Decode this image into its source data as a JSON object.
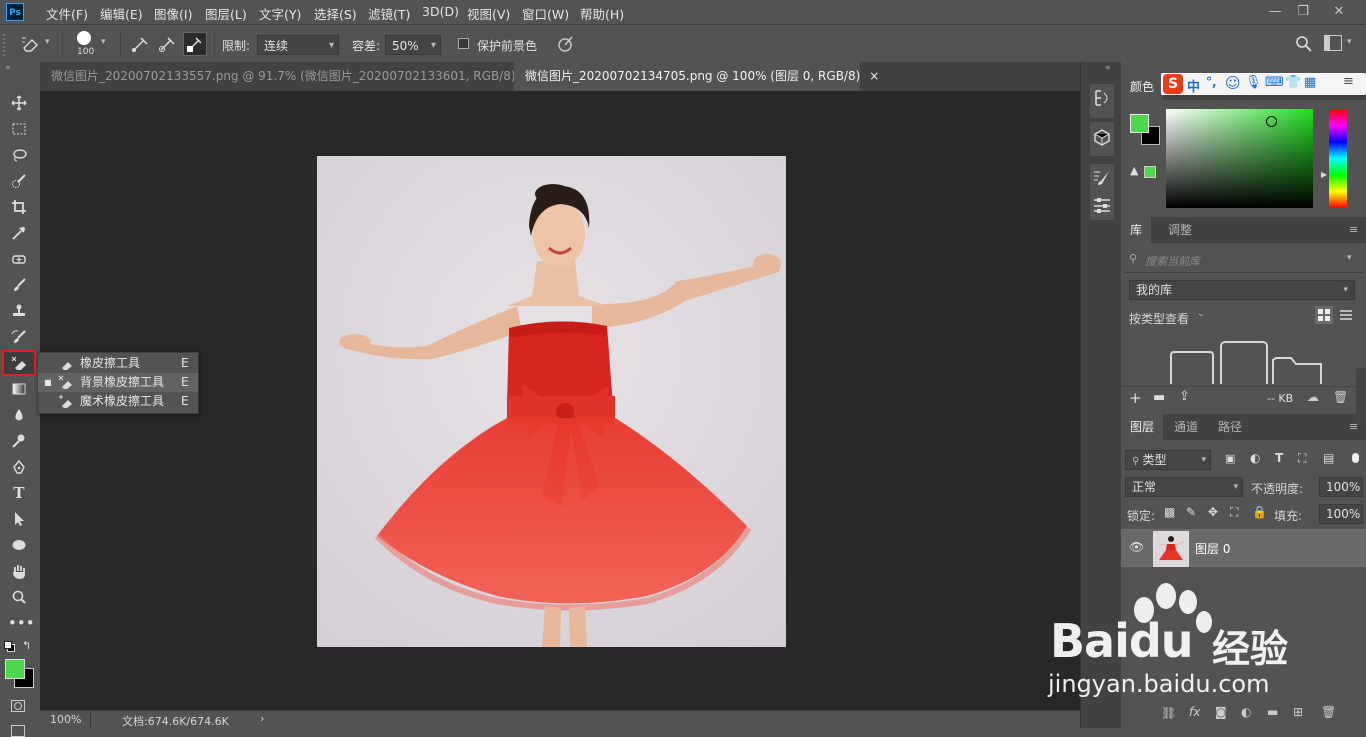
{
  "app": {
    "logo_text": "Ps"
  },
  "menu": [
    "文件(F)",
    "编辑(E)",
    "图像(I)",
    "图层(L)",
    "文字(Y)",
    "选择(S)",
    "滤镜(T)",
    "3D(D)",
    "视图(V)",
    "窗口(W)",
    "帮助(H)"
  ],
  "window_controls": {
    "minimize": "—",
    "restore": "❐",
    "close": "✕"
  },
  "options": {
    "brush_size": "100",
    "limit_label": "限制:",
    "limit_value": "连续",
    "tolerance_label": "容差:",
    "tolerance_value": "50%",
    "protect_fg_label": "保护前景色"
  },
  "tabs": [
    {
      "title": "微信图片_20200702133557.png @ 91.7% (微信图片_20200702133601, RGB/8) *",
      "close": "×"
    },
    {
      "title": "微信图片_20200702134705.png @ 100% (图层 0, RGB/8)",
      "close": "×"
    }
  ],
  "flyout": {
    "items": [
      {
        "label": "橡皮擦工具",
        "key": "E"
      },
      {
        "label": "背景橡皮擦工具",
        "key": "E"
      },
      {
        "label": "魔术橡皮擦工具",
        "key": "E"
      }
    ]
  },
  "status": {
    "zoom": "100%",
    "doc_info": "文档:674.6K/674.6K",
    "arrow": "›"
  },
  "color_panel": {
    "tab": "颜色",
    "foreground": "#4fd64f",
    "background": "#000000",
    "field_hue": "#22dd22"
  },
  "library_panel": {
    "tabs": [
      "库",
      "调整"
    ],
    "search_placeholder": "搜索当前库",
    "library_name": "我的库",
    "view_by": "按类型查看",
    "size_label": "-- KB"
  },
  "layers_panel": {
    "tabs": [
      "图层",
      "通道",
      "路径"
    ],
    "filter": "类型",
    "blend_mode": "正常",
    "opacity_label": "不透明度:",
    "opacity_value": "100%",
    "lock_label": "锁定:",
    "fill_label": "填充:",
    "fill_value": "100%",
    "layers": [
      {
        "name": "图层 0"
      }
    ]
  },
  "ime_bar": [
    "中",
    "°,"
  ],
  "watermark": {
    "brand": "Baidu",
    "brand_suffix": "经验",
    "url": "jingyan.baidu.com"
  },
  "colors": {
    "accent": "#31a8ff",
    "highlight": "#e02020",
    "dress": "#e8362c"
  }
}
